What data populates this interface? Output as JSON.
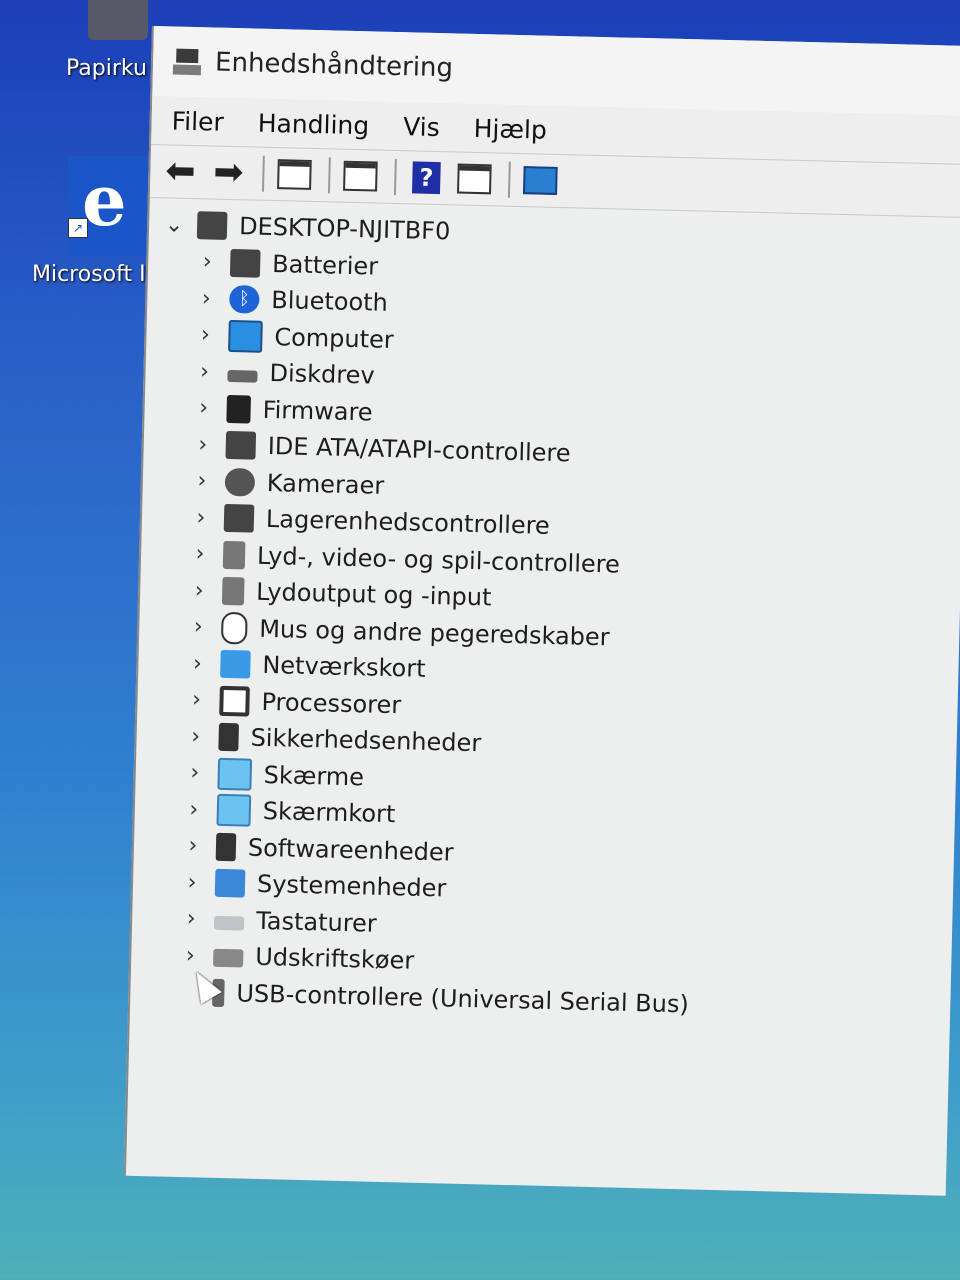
{
  "desktop": {
    "recycle_bin_label": "Papirku",
    "edge_label": "Microsoft I"
  },
  "window": {
    "title": "Enhedshåndtering"
  },
  "menu": [
    "Filer",
    "Handling",
    "Vis",
    "Hjælp"
  ],
  "toolbar": {
    "back_icon": "arrow-left-icon",
    "forward_icon": "arrow-right-icon",
    "help_glyph": "?"
  },
  "tree": {
    "root": "DESKTOP-NJITBF0",
    "items": [
      {
        "label": "Batterier",
        "icon": "battery-icon"
      },
      {
        "label": "Bluetooth",
        "icon": "bluetooth-icon"
      },
      {
        "label": "Computer",
        "icon": "computer-icon"
      },
      {
        "label": "Diskdrev",
        "icon": "disk-drive-icon"
      },
      {
        "label": "Firmware",
        "icon": "firmware-icon"
      },
      {
        "label": "IDE ATA/ATAPI-controllere",
        "icon": "ide-controller-icon"
      },
      {
        "label": "Kameraer",
        "icon": "camera-icon"
      },
      {
        "label": "Lagerenhedscontrollere",
        "icon": "storage-controller-icon"
      },
      {
        "label": "Lyd-, video- og spil-controllere",
        "icon": "sound-icon"
      },
      {
        "label": "Lydoutput og -input",
        "icon": "audio-io-icon"
      },
      {
        "label": "Mus og andre pegeredskaber",
        "icon": "mouse-icon"
      },
      {
        "label": "Netværkskort",
        "icon": "network-adapter-icon"
      },
      {
        "label": "Processorer",
        "icon": "processor-icon"
      },
      {
        "label": "Sikkerhedsenheder",
        "icon": "security-device-icon"
      },
      {
        "label": "Skærme",
        "icon": "monitor-icon"
      },
      {
        "label": "Skærmkort",
        "icon": "display-adapter-icon"
      },
      {
        "label": "Softwareenheder",
        "icon": "software-device-icon"
      },
      {
        "label": "Systemenheder",
        "icon": "system-device-icon"
      },
      {
        "label": "Tastaturer",
        "icon": "keyboard-icon"
      },
      {
        "label": "Udskriftskøer",
        "icon": "print-queue-icon"
      },
      {
        "label": "USB-controllere (Universal Serial Bus)",
        "icon": "usb-icon"
      }
    ]
  }
}
